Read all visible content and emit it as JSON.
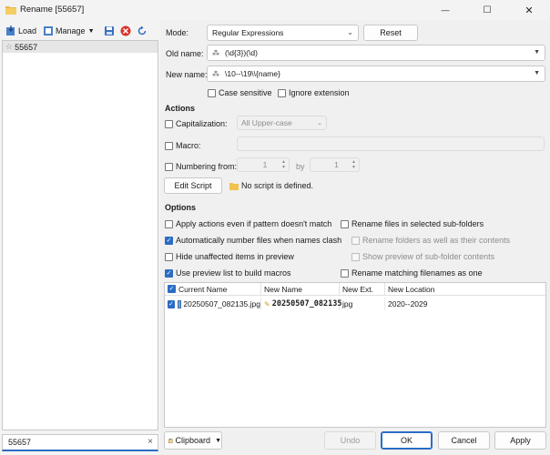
{
  "window": {
    "title": "Rename [55657]",
    "minimize": "—",
    "maximize": "☐",
    "close": "✕"
  },
  "left": {
    "load_label": "Load",
    "manage_label": "Manage",
    "items": [
      "55657"
    ],
    "search_value": "55657"
  },
  "form": {
    "mode_label": "Mode:",
    "mode_value": "Regular Expressions",
    "reset_label": "Reset",
    "old_name_label": "Old name:",
    "old_name_value": "(\\d{3})(\\d)",
    "new_name_label": "New name:",
    "new_name_value": "\\10--\\19\\\\{name}",
    "case_sensitive": "Case sensitive",
    "ignore_extension": "Ignore extension"
  },
  "actions": {
    "heading": "Actions",
    "capitalization_label": "Capitalization:",
    "capitalization_value": "All Upper-case",
    "macro_label": "Macro:",
    "numbering_label": "Numbering from:",
    "numbering_from": "1",
    "by_label": "by",
    "numbering_by": "1",
    "edit_script_label": "Edit Script",
    "script_status": "No script is defined."
  },
  "options": {
    "heading": "Options",
    "apply_actions": "Apply actions even if pattern doesn't match",
    "auto_number": "Automatically number files when names clash",
    "hide_unaffected": "Hide unaffected items in preview",
    "use_preview": "Use preview list to build macros",
    "rename_subfolders": "Rename files in selected sub-folders",
    "rename_folders_as_well": "Rename folders as well as their contents",
    "show_preview_subfolder": "Show preview of sub-folder contents",
    "rename_matching": "Rename matching filenames as one"
  },
  "table": {
    "headers": [
      "Current Name",
      "New Name",
      "New Ext.",
      "New Location"
    ],
    "rows": [
      {
        "current": "20250507_082135.jpg",
        "new_name": "20250507_082135",
        "ext": "jpg",
        "location": "2020--2029"
      }
    ]
  },
  "bottom": {
    "clipboard_label": "Clipboard",
    "undo_label": "Undo",
    "ok_label": "OK",
    "cancel_label": "Cancel",
    "apply_label": "Apply"
  },
  "colors": {
    "accent": "#2b6cc4",
    "delete_red": "#d9342b"
  }
}
